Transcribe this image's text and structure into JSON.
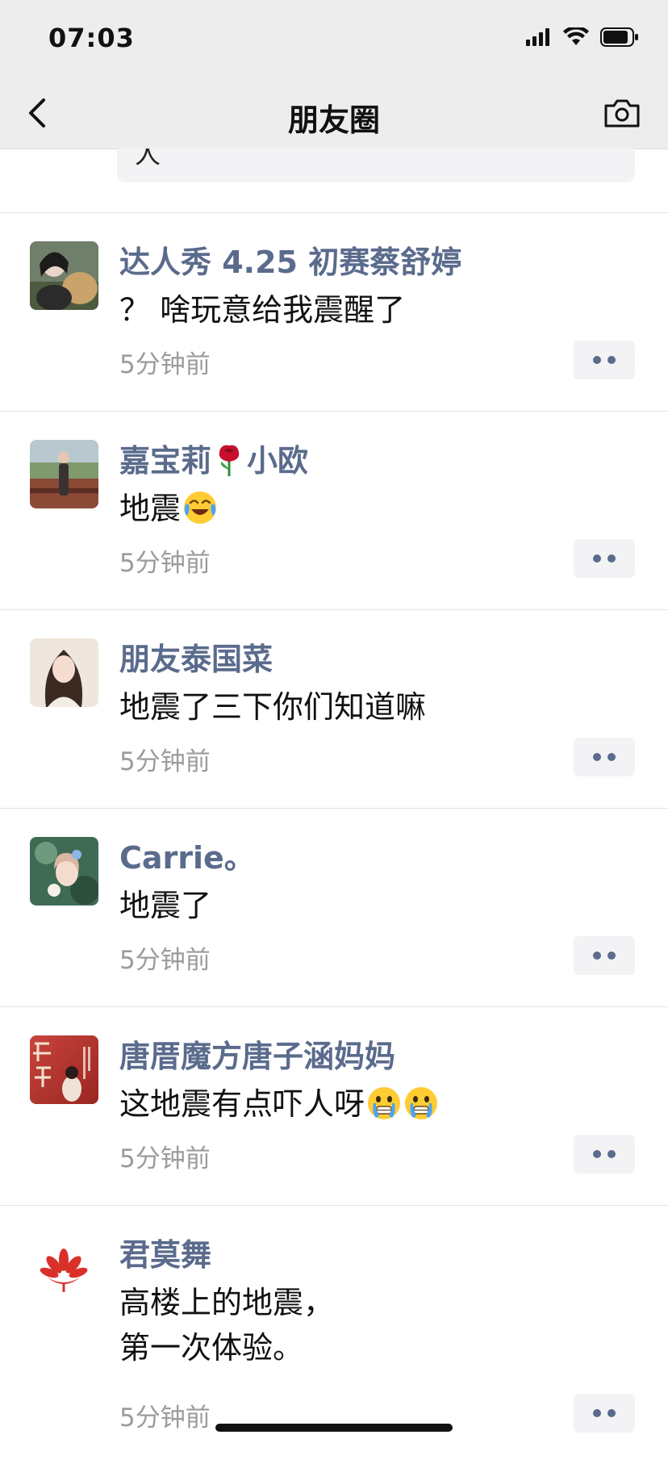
{
  "status_bar": {
    "time": "07:03"
  },
  "nav": {
    "title": "朋友圈"
  },
  "partial_comment": {
    "text": "人"
  },
  "comments": [
    {
      "name": "达人秀 4.25 初赛蔡舒婷",
      "text": "？ 啥玩意给我震醒了",
      "time": "5分钟前",
      "emojis": []
    },
    {
      "name_parts": [
        "嘉宝莉",
        "小欧"
      ],
      "text": "地震",
      "time": "5分钟前",
      "emojis": [
        "crying-laughing-emoji"
      ]
    },
    {
      "name": "朋友泰国菜",
      "text": "地震了三下你们知道嘛",
      "time": "5分钟前",
      "emojis": []
    },
    {
      "name": "Carrie。",
      "text": "地震了",
      "time": "5分钟前",
      "emojis": []
    },
    {
      "name": "唐厝魔方唐子涵妈妈",
      "text": "这地震有点吓人呀",
      "time": "5分钟前",
      "emojis": [
        "fearful-crying-emoji",
        "fearful-crying-emoji"
      ]
    },
    {
      "name": "君莫舞",
      "text": "高楼上的地震，\n第一次体验。",
      "time": "5分钟前",
      "emojis": []
    }
  ],
  "colors": {
    "name_link": "#5a6b8c",
    "timestamp": "#9b9b9b",
    "header_bg": "#ededed",
    "button_bg": "#f3f3f5"
  }
}
